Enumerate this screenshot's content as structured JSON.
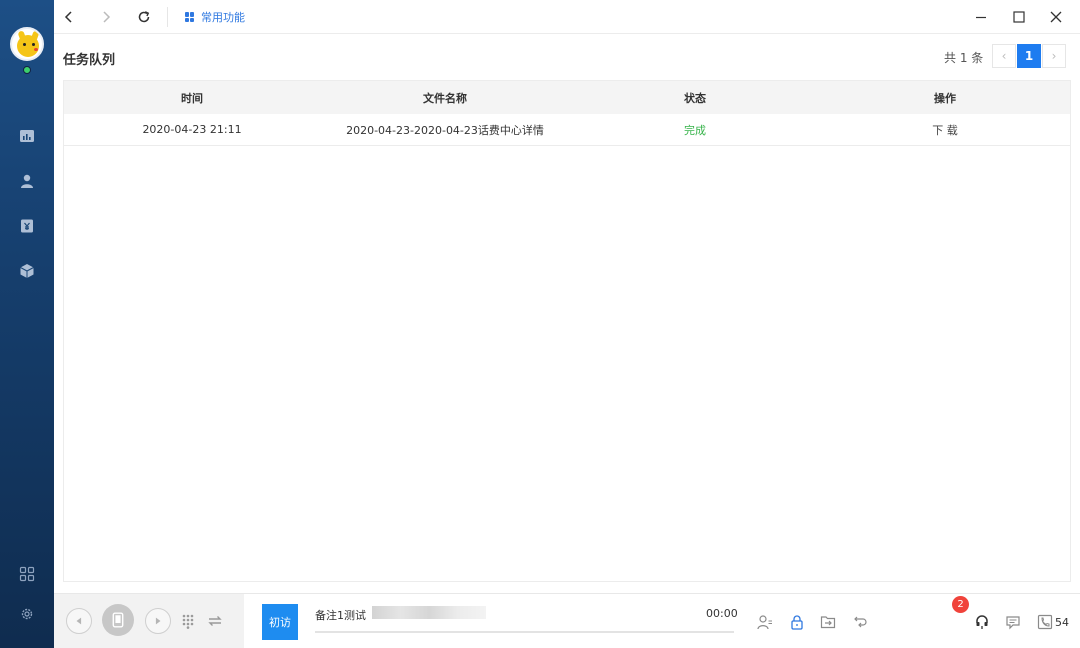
{
  "topbar": {
    "tab_label": "常用功能"
  },
  "page": {
    "title": "任务队列",
    "pager_total": "共 1 条",
    "current_page": "1"
  },
  "table": {
    "headers": [
      "时间",
      "文件名称",
      "状态",
      "操作"
    ],
    "rows": [
      {
        "time": "2020-04-23 21:11",
        "file_name": "2020-04-23-2020-04-23话费中心详情",
        "status": "完成",
        "action": "下 载"
      }
    ]
  },
  "callbar": {
    "first_visit_label": "初访",
    "remark_label": "备注1测试",
    "timer": "00:00",
    "badge_count": "2",
    "phone_count": "54",
    "progress_percent": 0
  },
  "colors": {
    "accent": "#1e7cf0",
    "status_done": "#37b34a",
    "sidebar_top": "#1d4f86",
    "sidebar_bottom": "#0f2c4f",
    "badge": "#f0433b"
  }
}
